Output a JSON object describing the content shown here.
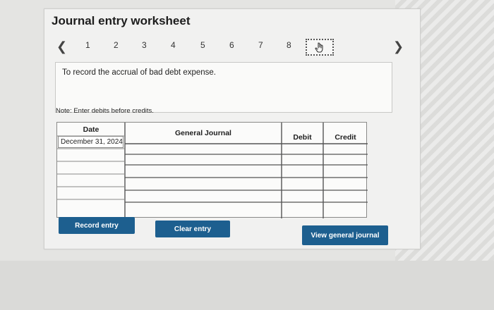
{
  "title": "Journal entry worksheet",
  "nav": {
    "prev_icon": "chevron-left-icon",
    "next_icon": "chevron-right-icon",
    "pages": [
      "1",
      "2",
      "3",
      "4",
      "5",
      "6",
      "7",
      "8"
    ],
    "active_icon": "hand-pointer-icon"
  },
  "instruction": "To record the accrual of bad debt expense.",
  "note": "Note: Enter debits before credits.",
  "table": {
    "headers": {
      "date": "Date",
      "journal": "General Journal",
      "debit": "Debit",
      "credit": "Credit"
    },
    "first_date": "December 31, 2024"
  },
  "buttons": {
    "record": "Record entry",
    "clear": "Clear entry",
    "view": "View general journal"
  },
  "colors": {
    "button": "#1d5f8f"
  }
}
